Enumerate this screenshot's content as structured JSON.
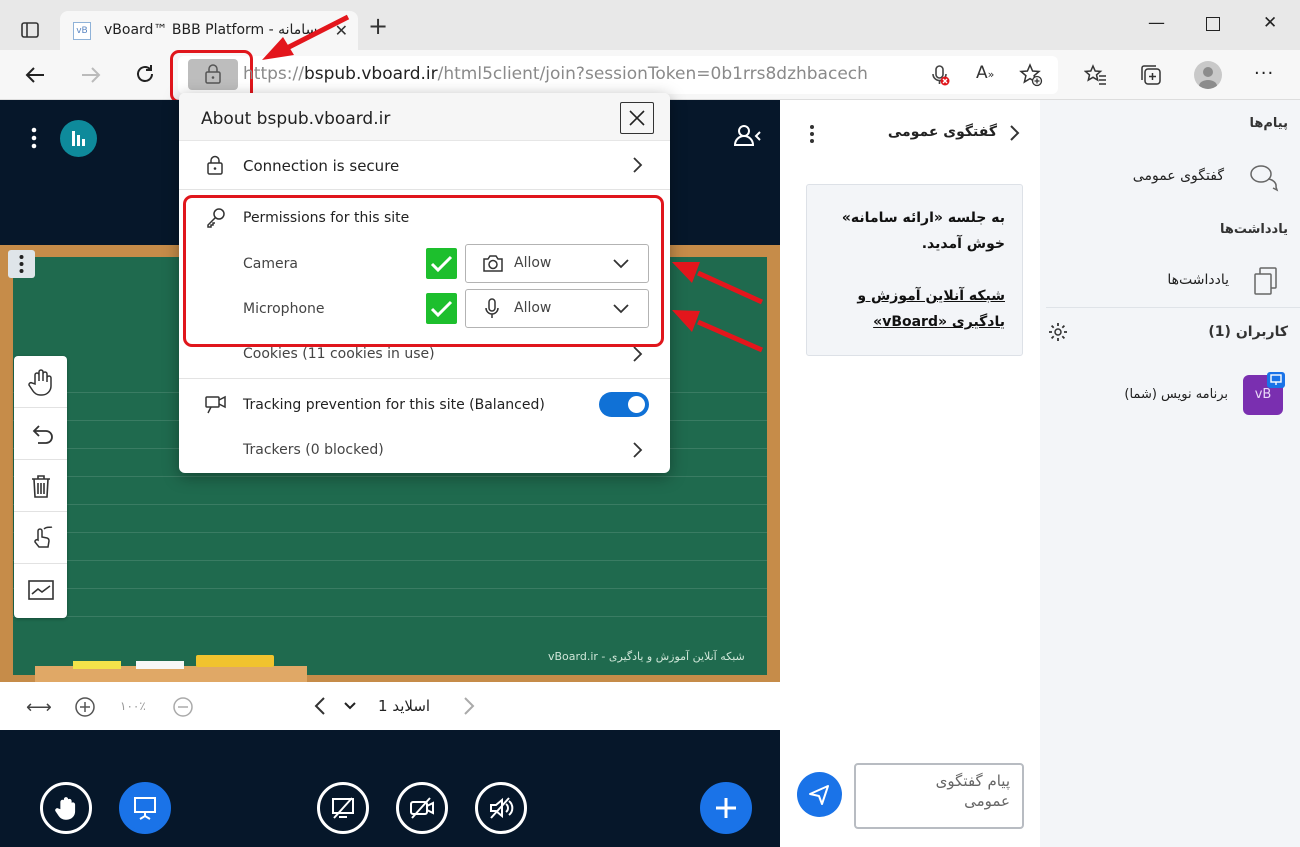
{
  "browser": {
    "tab_title": "vBoard™ BBB Platform - سامانه",
    "favicon_text": "vB",
    "url_host": "bspub.vboard.ir",
    "url_prefix": "https://",
    "url_path": "/html5client/join?sessionToken=0b1rrs8dzhbacech"
  },
  "popup": {
    "title": "About bspub.vboard.ir",
    "connection": "Connection is secure",
    "permissions_title": "Permissions for this site",
    "camera_label": "Camera",
    "camera_value": "Allow",
    "microphone_label": "Microphone",
    "microphone_value": "Allow",
    "cookies": "Cookies (11 cookies in use)",
    "tracking": "Tracking prevention for this site (Balanced)",
    "trackers": "Trackers (0 blocked)"
  },
  "presentation": {
    "board_caption": "vBoard.ir - شبکه آنلاین آموزش و یادگیری",
    "zoom": "۱۰۰٪",
    "slide_label": "اسلاید 1"
  },
  "chat": {
    "header": "گفتگوی عمومی",
    "welcome_line1": "به جلسه «ارائه سامانه»",
    "welcome_line2": "خوش آمدید.",
    "welcome_line3": "شبکه آنلاین آموزش و",
    "welcome_line4": "یادگیری «vBoard»",
    "input_placeholder_1": "پیام گفتگوی",
    "input_placeholder_2": "عمومی"
  },
  "sidebar": {
    "messages_title": "پیام‌ها",
    "public_chat": "گفتگوی عمومی",
    "notes_title": "یادداشت‌ها",
    "notes_item": "یادداشت‌ها",
    "users_title": "کاربران (1)",
    "user_name": "برنامه نویس (شما)",
    "avatar_text": "vB"
  },
  "colors": {
    "accent": "#1a73e8",
    "dark_bg": "#06172a",
    "board_green": "#1f6a4e",
    "annotation_red": "#e0161c",
    "check_green": "#1dbf2d"
  }
}
